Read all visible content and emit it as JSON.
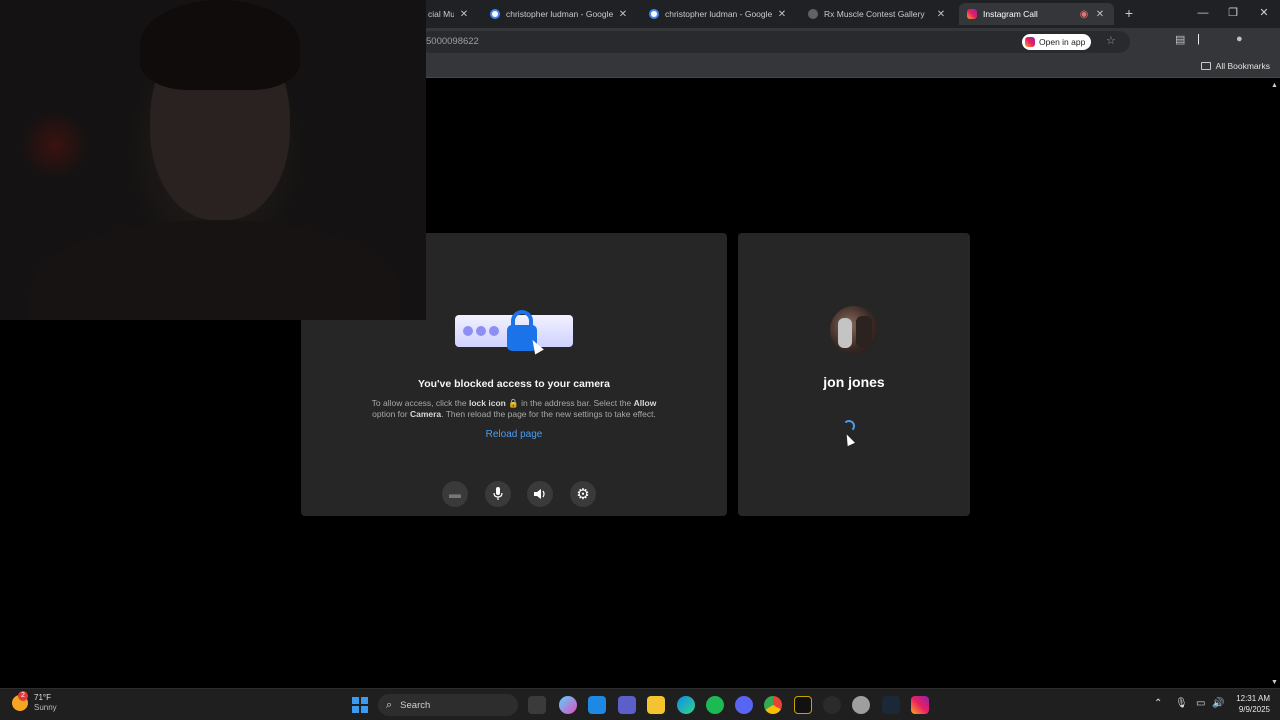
{
  "browser": {
    "tabs": [
      {
        "label": "cial Mu",
        "favicon": "fitness-icon"
      },
      {
        "label": "christopher ludman - Google S",
        "favicon": "google-icon"
      },
      {
        "label": "christopher ludman - Google S",
        "favicon": "google-icon"
      },
      {
        "label": "Rx Muscle Contest Gallery",
        "favicon": "globe-icon"
      },
      {
        "label": "Instagram Call",
        "favicon": "instagram-icon",
        "recording": true
      }
    ],
    "url": "5000098622",
    "open_in_app_label": "Open in app",
    "all_bookmarks_label": "All Bookmarks"
  },
  "call": {
    "blocked_title": "You've blocked access to your camera",
    "blocked_desc_1": "To allow access, click the",
    "lock_icon_label": "lock icon",
    "blocked_desc_2": "in the address bar. Select the",
    "allow_label": "Allow",
    "blocked_desc_3": "option for",
    "camera_label": "Camera",
    "blocked_desc_4": ". Then reload the page for the new settings to take effect.",
    "reload_label": "Reload page",
    "contact_name": "jon jones",
    "controls": [
      "camera-off",
      "microphone",
      "speaker",
      "settings"
    ]
  },
  "taskbar": {
    "weather_temp": "71°F",
    "weather_desc": "Sunny",
    "weather_badge": "2",
    "search_placeholder": "Search",
    "time": "12:31 AM",
    "date": "9/9/2025"
  },
  "colors": {
    "accent_blue": "#1a73e8",
    "link_blue": "#4a9cf0",
    "panel_bg": "#262626",
    "chrome_bg": "#35363a"
  }
}
